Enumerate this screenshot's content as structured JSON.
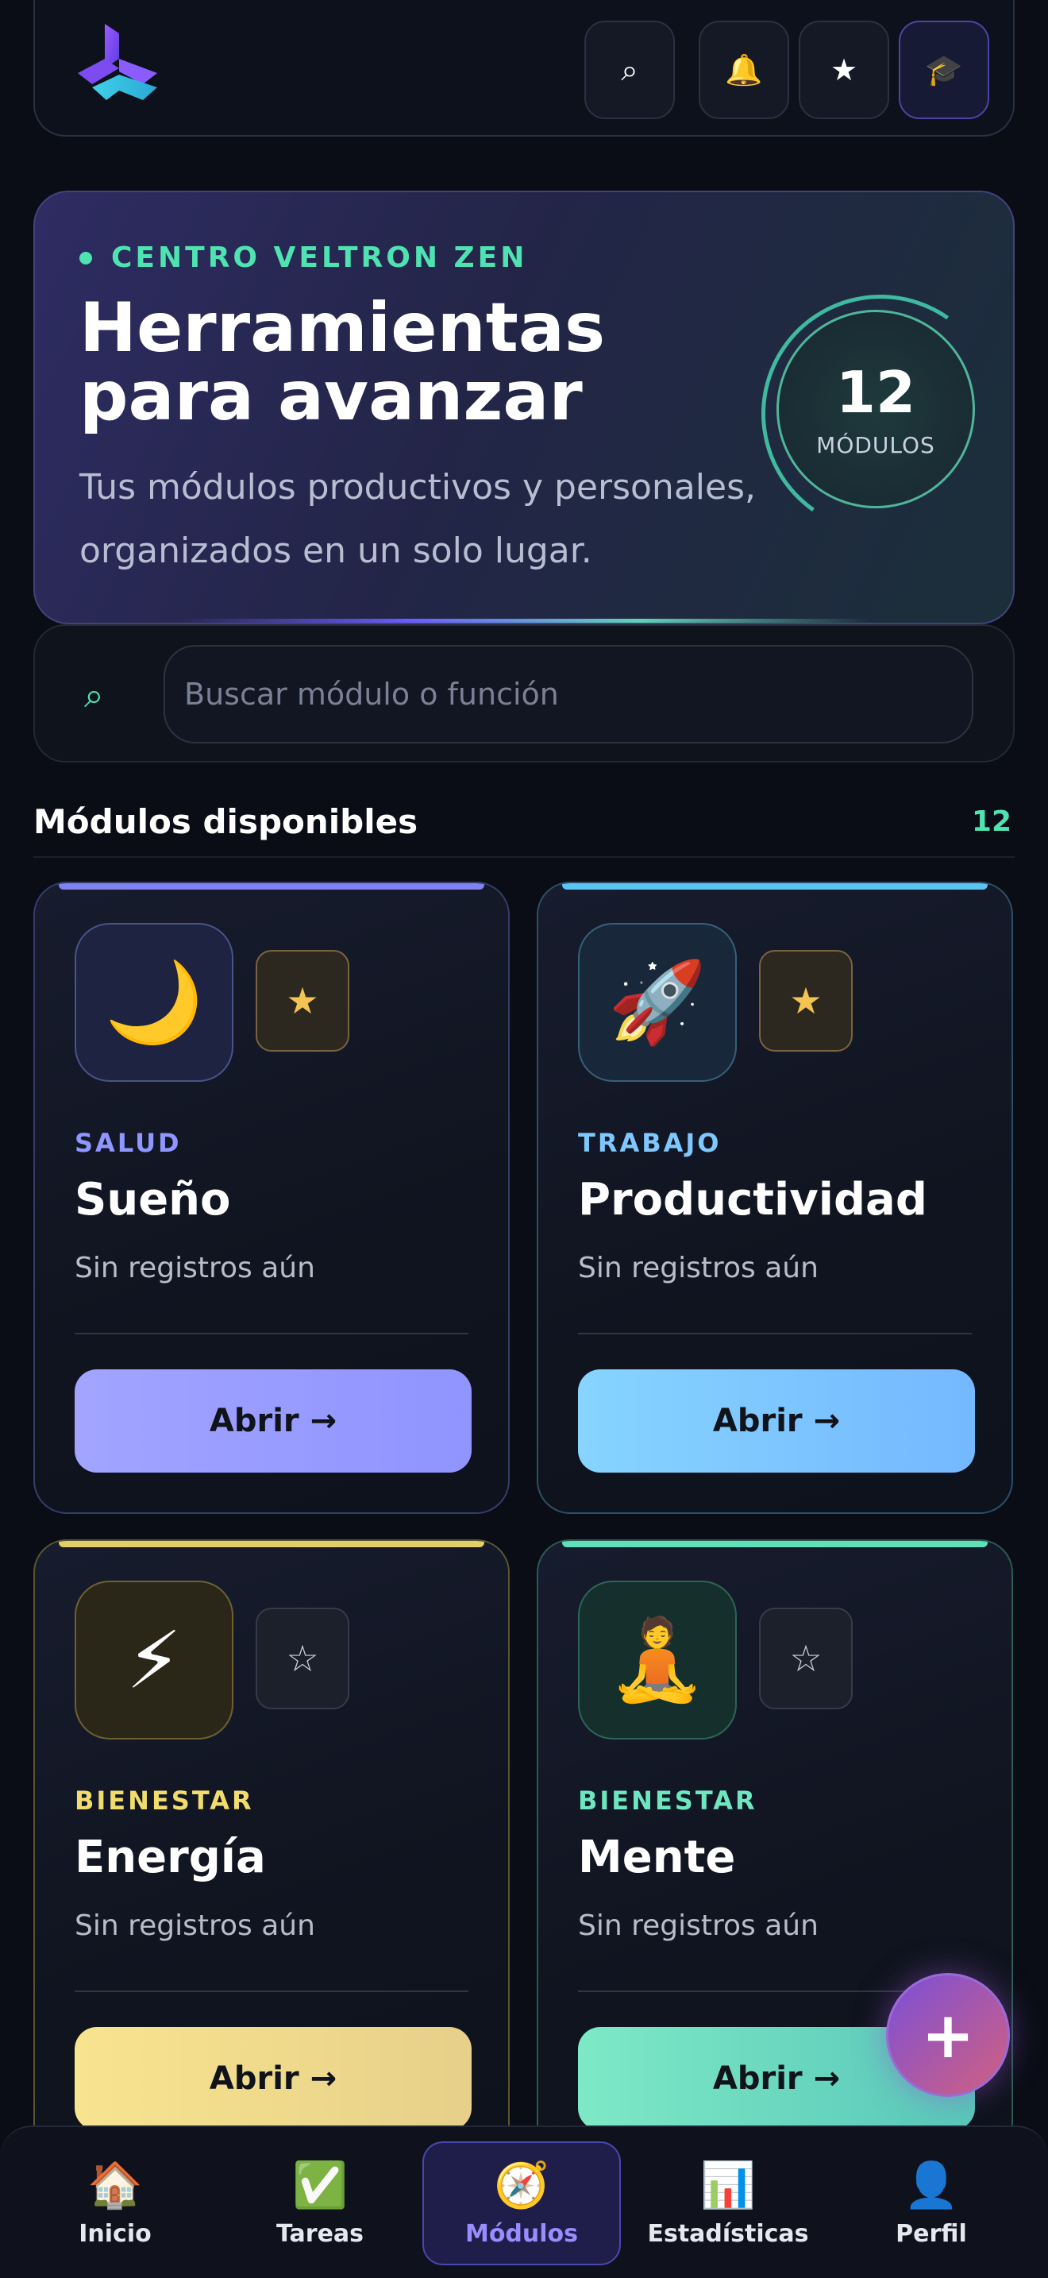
{
  "header": {
    "search_icon": "⌕",
    "bell_icon": "🔔",
    "star_icon": "★",
    "profile_icon": "🎓"
  },
  "hero": {
    "kicker": "CENTRO VELTRON ZEN",
    "title": "Herramientas para avanzar",
    "subtitle": "Tus módulos productivos y personales, organizados en un solo lugar.",
    "module_count": "12",
    "module_label": "MÓDULOS"
  },
  "search": {
    "icon": "⌕",
    "placeholder": "Buscar módulo o función",
    "value": ""
  },
  "section": {
    "title": "Módulos disponibles",
    "count": "12"
  },
  "modules": [
    {
      "icon": "🌙",
      "favorite_icon": "★",
      "category": "SALUD",
      "name": "Sueño",
      "status": "Sin registros aún",
      "button": "Abrir →",
      "accent": "#8f94ff"
    },
    {
      "icon": "🚀",
      "favorite_icon": "★",
      "category": "TRABAJO",
      "name": "Productividad",
      "status": "Sin registros aún",
      "button": "Abrir →",
      "accent": "#79c8ff"
    },
    {
      "icon": "⚡",
      "favorite_icon": "☆",
      "category": "BIENESTAR",
      "name": "Energía",
      "status": "Sin registros aún",
      "button": "Abrir →",
      "accent": "#f2dc7c"
    },
    {
      "icon": "🧘",
      "favorite_icon": "☆",
      "category": "BIENESTAR",
      "name": "Mente",
      "status": "Sin registros aún",
      "button": "Abrir →",
      "accent": "#6ee7c0"
    }
  ],
  "fab": {
    "label": "+"
  },
  "nav": [
    {
      "icon": "🏠",
      "label": "Inicio"
    },
    {
      "icon": "✅",
      "label": "Tareas"
    },
    {
      "icon": "🧭",
      "label": "Módulos"
    },
    {
      "icon": "📊",
      "label": "Estadísticas"
    },
    {
      "icon": "👤",
      "label": "Perfil"
    }
  ]
}
